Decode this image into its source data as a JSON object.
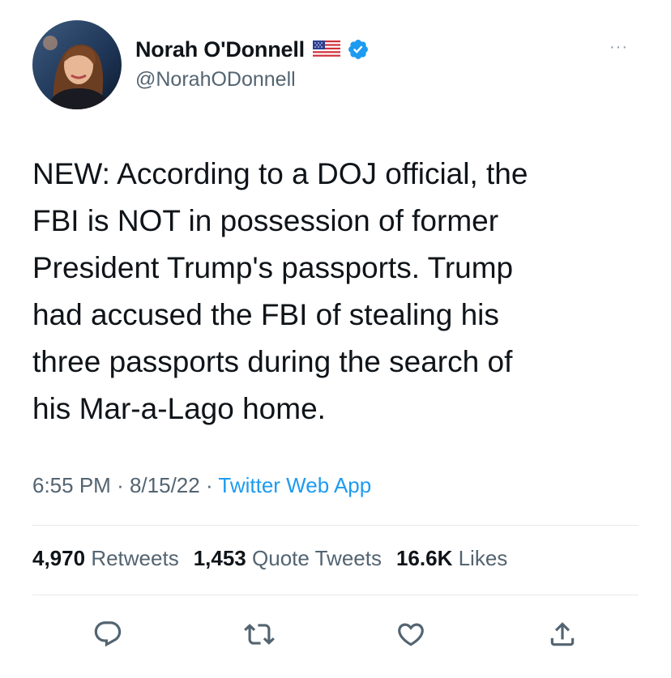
{
  "author": {
    "name": "Norah O'Donnell",
    "handle": "@NorahODonnell",
    "flag_icon": "us-flag-emoji",
    "verified_icon": "verified-badge-icon",
    "verified_color": "#1d9bf0"
  },
  "more_menu": {
    "label": "···"
  },
  "tweet": {
    "text": "NEW: According to a DOJ official, the\nFBI is NOT in possession of former\nPresident Trump's passports. Trump\nhad accused the FBI of stealing his\nthree passports during the search of\nhis Mar-a-Lago home."
  },
  "meta": {
    "time": "6:55 PM",
    "separator": "·",
    "date": "8/15/22",
    "source": "Twitter Web App"
  },
  "stats": {
    "retweets_count": "4,970",
    "retweets_label": "Retweets",
    "quotes_count": "1,453",
    "quotes_label": "Quote Tweets",
    "likes_count": "16.6K",
    "likes_label": "Likes"
  },
  "actions": [
    "reply-icon",
    "retweet-icon",
    "like-icon",
    "share-icon"
  ],
  "colors": {
    "link": "#1d9bf0",
    "secondary_text": "#536471",
    "divider": "#e7e9ea"
  }
}
